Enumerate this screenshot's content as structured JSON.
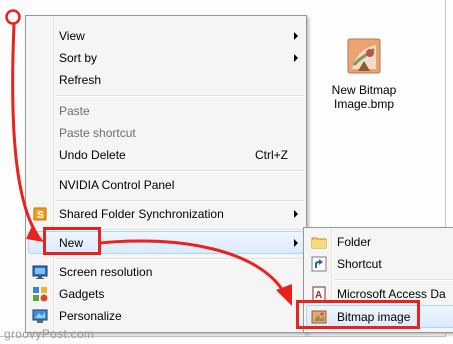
{
  "context_menu": {
    "items": [
      {
        "label": "View",
        "submenu": true
      },
      {
        "label": "Sort by",
        "submenu": true
      },
      {
        "label": "Refresh"
      },
      {
        "label": "Paste",
        "disabled": true
      },
      {
        "label": "Paste shortcut",
        "disabled": true
      },
      {
        "label": "Undo Delete",
        "shortcut": "Ctrl+Z"
      },
      {
        "label": "NVIDIA Control Panel"
      },
      {
        "label": "Shared Folder Synchronization",
        "submenu": true,
        "icon": "sync-icon"
      },
      {
        "label": "New",
        "submenu": true,
        "highlighted": true
      },
      {
        "label": "Screen resolution",
        "icon": "monitor-icon"
      },
      {
        "label": "Gadgets",
        "icon": "gadgets-icon"
      },
      {
        "label": "Personalize",
        "icon": "personalize-icon"
      }
    ]
  },
  "new_submenu": {
    "items": [
      {
        "label": "Folder",
        "icon": "folder-icon"
      },
      {
        "label": "Shortcut",
        "icon": "shortcut-icon"
      },
      {
        "label": "Microsoft Access Da",
        "icon": "access-icon"
      },
      {
        "label": "Bitmap image",
        "icon": "bitmap-icon",
        "highlighted": true
      }
    ]
  },
  "desktop_file": {
    "name_line1": "New Bitmap",
    "name_line2": "Image.bmp",
    "icon": "bitmap-file-icon"
  },
  "watermark": "groovyPost.com",
  "colors": {
    "annotation_red": "#e8221c",
    "menu_bg": "#f5f5f5",
    "highlight_border": "#a8d8fb"
  }
}
